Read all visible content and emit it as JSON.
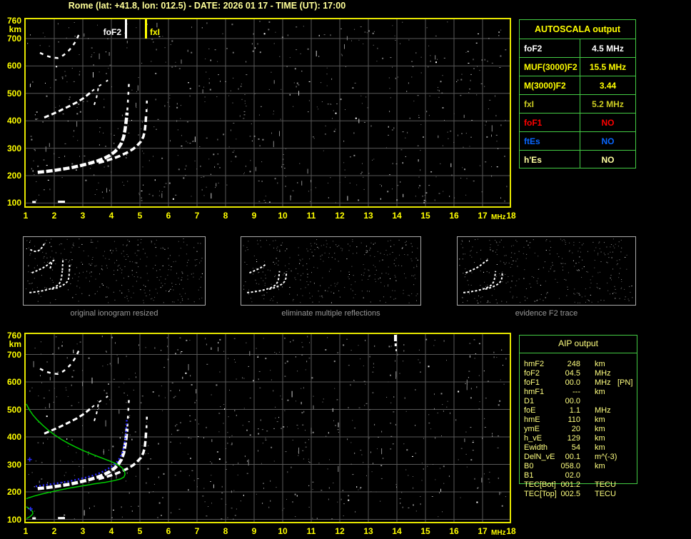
{
  "title": "Rome (lat: +41.8, lon: 012.5) - DATE: 2026 01 17 - TIME (UT): 17:00",
  "colors": {
    "background": "#000000",
    "title": "#ffff99",
    "axis": "#ffff00",
    "plot_border": "#e6e600",
    "grid": "#585858",
    "table_border": "#44cc44",
    "aip_text": "#ffff80",
    "trace": "#ffffff",
    "scaled_trace_blue": "#2a2aff",
    "profile_green": "#00cc00"
  },
  "autoscala_table": {
    "header": "AUTOSCALA output",
    "rows": [
      {
        "param": "foF2",
        "value": "4.5 MHz",
        "color": "#ffffff"
      },
      {
        "param": "MUF(3000)F2",
        "value": "15.5 MHz",
        "color": "#ffff00"
      },
      {
        "param": "M(3000)F2",
        "value": "3.44",
        "color": "#ffff00"
      },
      {
        "param": "fxI",
        "value": "5.2 MHz",
        "color": "#cccc22"
      },
      {
        "param": "foF1",
        "value": "NO",
        "color": "#ff0000"
      },
      {
        "param": "ftEs",
        "value": "NO",
        "color": "#0866ff"
      },
      {
        "param": "h'Es",
        "value": "NO",
        "color": "#ffffa0"
      }
    ]
  },
  "aip_table": {
    "header": "AIP output",
    "rows": [
      {
        "param": "hmF2",
        "value": "248",
        "unit": "km",
        "note": ""
      },
      {
        "param": "foF2",
        "value": "04.5",
        "unit": "MHz",
        "note": ""
      },
      {
        "param": "foF1",
        "value": "00.0",
        "unit": "MHz",
        "note": "[PN]"
      },
      {
        "param": "hmF1",
        "value": "---",
        "unit": "km",
        "note": ""
      },
      {
        "param": "D1",
        "value": "00.0",
        "unit": "",
        "note": ""
      },
      {
        "param": "foE",
        "value": "1.1",
        "unit": "MHz",
        "note": ""
      },
      {
        "param": "hmE",
        "value": "110",
        "unit": "km",
        "note": ""
      },
      {
        "param": "ymE",
        "value": "20",
        "unit": "km",
        "note": ""
      },
      {
        "param": "h_vE",
        "value": "129",
        "unit": "km",
        "note": ""
      },
      {
        "param": "Ewidth",
        "value": "54",
        "unit": "km",
        "note": ""
      },
      {
        "param": "DelN_vE",
        "value": "00.1",
        "unit": "m^(-3)",
        "note": ""
      },
      {
        "param": "B0",
        "value": "058.0",
        "unit": "km",
        "note": ""
      },
      {
        "param": "B1",
        "value": "02.0",
        "unit": "",
        "note": ""
      },
      {
        "param": "TEC[Bot]",
        "value": "001.2",
        "unit": "TECU",
        "note": ""
      },
      {
        "param": "TEC[Top]",
        "value": "002.5",
        "unit": "TECU",
        "note": ""
      }
    ]
  },
  "thumbnails": [
    {
      "caption": "original ionogram resized"
    },
    {
      "caption": "eliminate multiple reflections"
    },
    {
      "caption": "evidence F2 trace"
    }
  ],
  "axes": {
    "y_unit": "km",
    "y_ticks": [
      760,
      700,
      600,
      500,
      400,
      300,
      200,
      100
    ],
    "x_ticks": [
      1,
      2,
      3,
      4,
      5,
      6,
      7,
      8,
      9,
      10,
      11,
      12,
      13,
      14,
      15,
      16,
      17,
      18
    ],
    "x_unit": "MHz"
  },
  "chart_data": [
    {
      "id": "top-ionogram",
      "type": "scatter",
      "title": "autoscaled ionogram",
      "xlabel": "MHz",
      "ylabel": "km",
      "xlim": [
        1,
        18
      ],
      "ylim": [
        90,
        772
      ],
      "grid": true,
      "annotations": [
        {
          "label": "foF2",
          "freq": 4.5,
          "color": "#ffffff",
          "side": "left"
        },
        {
          "label": "fxI",
          "freq": 5.2,
          "color": "#ffff00",
          "side": "right"
        }
      ],
      "series": [
        {
          "name": "f2-o-main",
          "color": "#ffffff",
          "points": [
            [
              1.42,
              212
            ],
            [
              1.7,
              215
            ],
            [
              2.0,
              219
            ],
            [
              2.3,
              224
            ],
            [
              2.6,
              229
            ],
            [
              2.9,
              236
            ],
            [
              3.2,
              244
            ],
            [
              3.5,
              253
            ],
            [
              3.75,
              263
            ],
            [
              3.95,
              274
            ],
            [
              4.12,
              287
            ],
            [
              4.25,
              301
            ],
            [
              4.35,
              318
            ],
            [
              4.43,
              341
            ],
            [
              4.48,
              368
            ],
            [
              4.52,
              400
            ],
            [
              4.55,
              430
            ]
          ]
        },
        {
          "name": "f2-o-upper",
          "color": "#ffffff",
          "points": [
            [
              4.56,
              438
            ],
            [
              4.58,
              472
            ],
            [
              4.6,
              508
            ],
            [
              4.62,
              545
            ]
          ]
        },
        {
          "name": "f2-x-main",
          "color": "#ffffff",
          "points": [
            [
              3.55,
              247
            ],
            [
              3.8,
              254
            ],
            [
              4.05,
              262
            ],
            [
              4.3,
              272
            ],
            [
              4.55,
              284
            ],
            [
              4.75,
              296
            ],
            [
              4.9,
              309
            ],
            [
              5.03,
              324
            ],
            [
              5.12,
              342
            ],
            [
              5.17,
              363
            ],
            [
              5.2,
              392
            ],
            [
              5.22,
              425
            ]
          ]
        },
        {
          "name": "f2-x-upper",
          "color": "#ffffff",
          "points": [
            [
              5.23,
              432
            ],
            [
              5.24,
              462
            ],
            [
              5.25,
              492
            ]
          ]
        },
        {
          "name": "second-hop",
          "color": "#ffffff",
          "points": [
            [
              1.65,
              412
            ],
            [
              1.9,
              423
            ],
            [
              2.2,
              437
            ],
            [
              2.5,
              452
            ],
            [
              2.8,
              468
            ],
            [
              3.0,
              481
            ],
            [
              3.15,
              493
            ],
            [
              3.3,
              506
            ]
          ]
        },
        {
          "name": "second-hop-upper",
          "color": "#ffffff",
          "points": [
            [
              3.32,
              508
            ],
            [
              3.5,
              522
            ],
            [
              3.7,
              536
            ],
            [
              3.88,
              548
            ]
          ]
        },
        {
          "name": "second-hop-x",
          "color": "#ffffff",
          "points": [
            [
              3.4,
              458
            ],
            [
              3.48,
              485
            ],
            [
              3.53,
              512
            ],
            [
              3.56,
              532
            ]
          ]
        },
        {
          "name": "third-hop",
          "color": "#ffffff",
          "points": [
            [
              1.5,
              648
            ],
            [
              1.7,
              638
            ],
            [
              1.92,
              631
            ],
            [
              2.12,
              629
            ],
            [
              2.32,
              639
            ],
            [
              2.48,
              653
            ],
            [
              2.62,
              669
            ],
            [
              2.72,
              685
            ],
            [
              2.8,
              701
            ],
            [
              2.87,
              716
            ]
          ]
        }
      ]
    },
    {
      "id": "bottom-ionogram",
      "type": "scatter",
      "title": "ionogram with scaled trace and electron density profile",
      "xlabel": "MHz",
      "ylabel": "km",
      "xlim": [
        1,
        18
      ],
      "ylim": [
        90,
        772
      ],
      "grid": true,
      "annotations": [],
      "series": [
        {
          "name": "f2-o-main",
          "color": "#ffffff",
          "points": [
            [
              1.42,
              212
            ],
            [
              1.7,
              215
            ],
            [
              2.0,
              219
            ],
            [
              2.3,
              224
            ],
            [
              2.6,
              229
            ],
            [
              2.9,
              236
            ],
            [
              3.2,
              244
            ],
            [
              3.5,
              253
            ],
            [
              3.75,
              263
            ],
            [
              3.95,
              274
            ],
            [
              4.12,
              287
            ],
            [
              4.25,
              301
            ],
            [
              4.35,
              318
            ],
            [
              4.43,
              341
            ],
            [
              4.48,
              368
            ],
            [
              4.52,
              400
            ],
            [
              4.55,
              430
            ]
          ]
        },
        {
          "name": "f2-o-upper",
          "color": "#ffffff",
          "points": [
            [
              4.56,
              438
            ],
            [
              4.58,
              472
            ],
            [
              4.6,
              508
            ],
            [
              4.62,
              545
            ]
          ]
        },
        {
          "name": "f2-x-main",
          "color": "#ffffff",
          "points": [
            [
              3.55,
              247
            ],
            [
              3.8,
              254
            ],
            [
              4.05,
              262
            ],
            [
              4.3,
              272
            ],
            [
              4.55,
              284
            ],
            [
              4.75,
              296
            ],
            [
              4.9,
              309
            ],
            [
              5.03,
              324
            ],
            [
              5.12,
              342
            ],
            [
              5.17,
              363
            ],
            [
              5.2,
              392
            ],
            [
              5.22,
              425
            ]
          ]
        },
        {
          "name": "f2-x-upper",
          "color": "#ffffff",
          "points": [
            [
              5.23,
              432
            ],
            [
              5.24,
              462
            ],
            [
              5.25,
              492
            ]
          ]
        },
        {
          "name": "second-hop",
          "color": "#ffffff",
          "points": [
            [
              1.65,
              412
            ],
            [
              1.9,
              423
            ],
            [
              2.2,
              437
            ],
            [
              2.5,
              452
            ],
            [
              2.8,
              468
            ],
            [
              3.0,
              481
            ],
            [
              3.15,
              493
            ],
            [
              3.3,
              506
            ]
          ]
        },
        {
          "name": "second-hop-upper",
          "color": "#ffffff",
          "points": [
            [
              3.32,
              508
            ],
            [
              3.5,
              522
            ],
            [
              3.7,
              536
            ],
            [
              3.88,
              548
            ]
          ]
        },
        {
          "name": "second-hop-x",
          "color": "#ffffff",
          "points": [
            [
              3.4,
              458
            ],
            [
              3.48,
              485
            ],
            [
              3.53,
              512
            ],
            [
              3.56,
              532
            ]
          ]
        },
        {
          "name": "third-hop",
          "color": "#ffffff",
          "points": [
            [
              1.5,
              648
            ],
            [
              1.7,
              638
            ],
            [
              1.92,
              631
            ],
            [
              2.12,
              629
            ],
            [
              2.32,
              639
            ],
            [
              2.48,
              653
            ],
            [
              2.62,
              669
            ],
            [
              2.72,
              685
            ],
            [
              2.8,
              701
            ],
            [
              2.87,
              716
            ]
          ]
        },
        {
          "name": "scaled-trace-blue",
          "color": "#2a2aff",
          "points": [
            [
              1.35,
              220
            ],
            [
              1.6,
              224
            ],
            [
              1.9,
              228
            ],
            [
              2.2,
              233
            ],
            [
              2.5,
              238
            ],
            [
              2.8,
              245
            ],
            [
              3.1,
              252
            ],
            [
              3.4,
              261
            ],
            [
              3.65,
              271
            ],
            [
              3.85,
              282
            ],
            [
              4.05,
              295
            ],
            [
              4.2,
              309
            ],
            [
              4.32,
              327
            ],
            [
              4.41,
              351
            ],
            [
              4.47,
              381
            ],
            [
              4.51,
              415
            ],
            [
              4.53,
              448
            ],
            [
              4.54,
              462
            ]
          ]
        },
        {
          "name": "profile-f2-green",
          "color": "#00cc00",
          "points": [
            [
              1.02,
              520
            ],
            [
              1.12,
              500
            ],
            [
              1.25,
              480
            ],
            [
              1.4,
              462
            ],
            [
              1.6,
              442
            ],
            [
              1.8,
              424
            ],
            [
              2.0,
              408
            ],
            [
              2.25,
              391
            ],
            [
              2.5,
              376
            ],
            [
              2.75,
              363
            ],
            [
              3.0,
              351
            ],
            [
              3.25,
              340
            ],
            [
              3.5,
              330
            ],
            [
              3.75,
              320
            ],
            [
              3.95,
              312
            ],
            [
              4.15,
              303
            ],
            [
              4.3,
              294
            ],
            [
              4.4,
              285
            ],
            [
              4.46,
              274
            ],
            [
              4.48,
              264
            ],
            [
              4.44,
              254
            ],
            [
              4.32,
              247
            ],
            [
              4.1,
              241
            ],
            [
              3.8,
              235
            ],
            [
              3.4,
              229
            ],
            [
              3.0,
              222
            ],
            [
              2.6,
              215
            ],
            [
              2.2,
              207
            ],
            [
              1.85,
              199
            ],
            [
              1.55,
              192
            ],
            [
              1.3,
              185
            ],
            [
              1.12,
              179
            ],
            [
              1.02,
              175
            ]
          ]
        },
        {
          "name": "profile-e-green",
          "color": "#00cc00",
          "points": [
            [
              1.02,
              146
            ],
            [
              1.1,
              141
            ],
            [
              1.18,
              135
            ],
            [
              1.24,
              128
            ],
            [
              1.25,
              121
            ],
            [
              1.2,
              114
            ],
            [
              1.12,
              108
            ],
            [
              1.03,
              103
            ]
          ]
        },
        {
          "name": "blue-plus-markers",
          "color": "#2a2aff",
          "points": [
            [
              1.14,
              318
            ],
            [
              1.17,
              138
            ]
          ]
        }
      ]
    }
  ]
}
